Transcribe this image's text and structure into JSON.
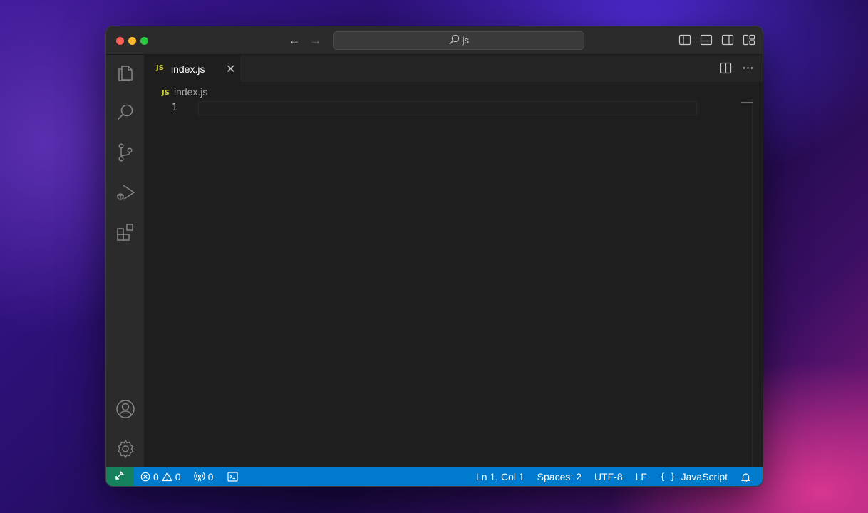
{
  "titlebar": {
    "search_text": "js",
    "nav_back": "←",
    "nav_forward": "→"
  },
  "tabs": [
    {
      "badge": "JS",
      "label": "index.js",
      "close": "✕"
    }
  ],
  "breadcrumb": {
    "badge": "JS",
    "file": "index.js"
  },
  "editor": {
    "lines": [
      "1"
    ]
  },
  "statusbar": {
    "remote_icon": "⨉",
    "errors": "0",
    "warnings": "0",
    "ports": "0",
    "position": "Ln 1, Col 1",
    "spaces": "Spaces: 2",
    "encoding": "UTF-8",
    "eol": "LF",
    "language_braces": "{ }",
    "language": "JavaScript"
  },
  "colors": {
    "statusbar": "#007acc",
    "remote": "#16825d",
    "js_badge": "#cbcb41",
    "editor_bg": "#1e1e1e"
  }
}
